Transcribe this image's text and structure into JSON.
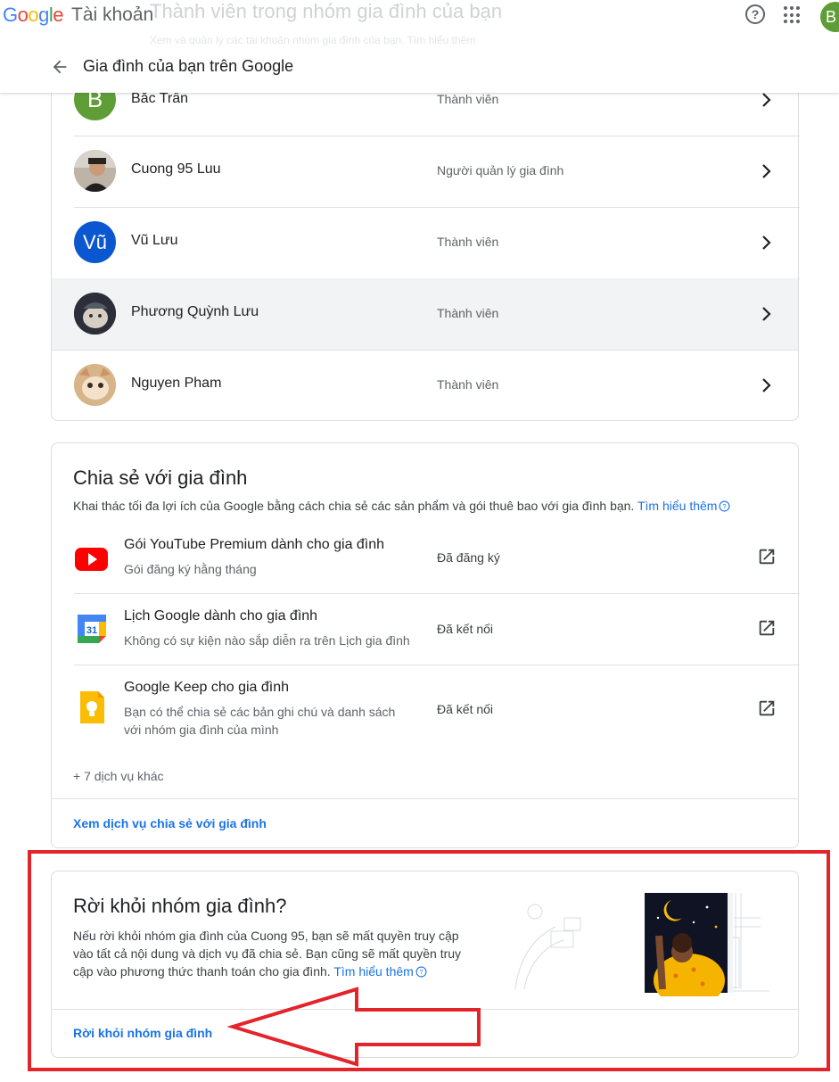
{
  "header": {
    "logo": "Google",
    "account_label": "Tài khoản",
    "faded_heading": "Thành viên trong nhóm gia đình của bạn",
    "faded_sub": "Xem và quản lý các tài khoản nhóm gia đình của bạn. Tìm hiểu thêm",
    "avatar_letter": "B",
    "page_title": "Gia đình của bạn trên Google"
  },
  "members": [
    {
      "name": "Bắc Trần",
      "role": "Thành viên",
      "avatar": "B",
      "avatar_color": "#5f9e36"
    },
    {
      "name": "Cuong 95 Luu",
      "role": "Người quản lý gia đình",
      "avatar": "photo"
    },
    {
      "name": "Vũ Lưu",
      "role": "Thành viên",
      "avatar": "Vũ",
      "avatar_color": "#0b57d0"
    },
    {
      "name": "Phương Quỳnh Lưu",
      "role": "Thành viên",
      "avatar": "photo"
    },
    {
      "name": "Nguyen Pham",
      "role": "Thành viên",
      "avatar": "photo"
    }
  ],
  "share": {
    "title": "Chia sẻ với gia đình",
    "desc": "Khai thác tối đa lợi ích của Google bằng cách chia sẻ các sản phẩm và gói thuê bao với gia đình bạn.",
    "learn_more": "Tìm hiểu thêm",
    "services": [
      {
        "name": "Gói YouTube Premium dành cho gia đình",
        "sub": "Gói đăng ký hằng tháng",
        "status": "Đã đăng ký",
        "icon": "youtube-icon"
      },
      {
        "name": "Lịch Google dành cho gia đình",
        "sub": "Không có sự kiện nào sắp diễn ra trên Lịch gia đình",
        "status": "Đã kết nối",
        "icon": "calendar-icon",
        "calendar_day": "31"
      },
      {
        "name": "Google Keep cho gia đình",
        "sub": "Bạn có thể chia sẻ các bản ghi chú và danh sách với nhóm gia đình của mình",
        "status": "Đã kết nối",
        "icon": "keep-icon"
      }
    ],
    "more": "+ 7 dịch vụ khác",
    "view_link": "Xem dịch vụ chia sẻ với gia đình"
  },
  "leave": {
    "title": "Rời khỏi nhóm gia đình?",
    "desc": "Nếu rời khỏi nhóm gia đình của Cuong 95, bạn sẽ mất quyền truy cập vào tất cả nội dung và dịch vụ đã chia sẻ. Bạn cũng sẽ mất quyền truy cập vào phương thức thanh toán cho gia đình.",
    "learn_more": "Tìm hiểu thêm",
    "action": "Rời khỏi nhóm gia đình"
  },
  "colors": {
    "accent": "#1a73e8",
    "annotation": "#e3242b"
  }
}
